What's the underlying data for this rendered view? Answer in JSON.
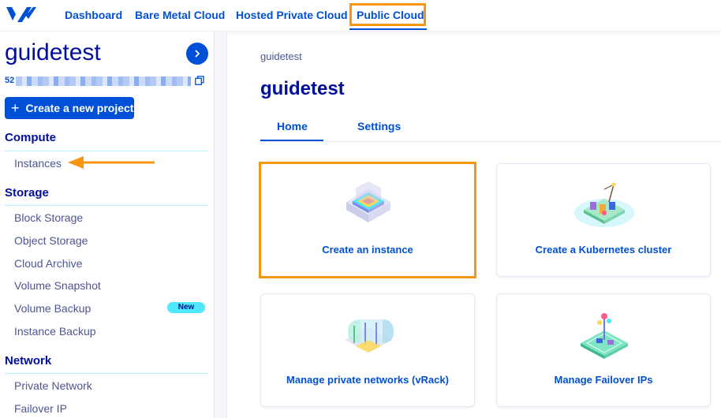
{
  "topnav": {
    "items": [
      {
        "label": "Dashboard"
      },
      {
        "label": "Bare Metal Cloud"
      },
      {
        "label": "Hosted Private Cloud"
      },
      {
        "label": "Public Cloud"
      }
    ],
    "active": "Public Cloud"
  },
  "sidebar": {
    "project_name": "guidetest",
    "project_id_prefix": "52",
    "create_project_label": "Create a new project",
    "sections": [
      {
        "title": "Compute",
        "items": [
          "Instances"
        ]
      },
      {
        "title": "Storage",
        "items": [
          "Block Storage",
          "Object Storage",
          "Cloud Archive",
          "Volume Snapshot",
          "Volume Backup",
          "Instance Backup"
        ]
      },
      {
        "title": "Network",
        "items": [
          "Private Network",
          "Failover IP"
        ]
      }
    ],
    "new_badge": "New"
  },
  "main": {
    "breadcrumb": "guidetest",
    "title": "guidetest",
    "tabs": [
      {
        "label": "Home"
      },
      {
        "label": "Settings"
      }
    ],
    "tiles": [
      {
        "label": "Create an instance"
      },
      {
        "label": "Create a Kubernetes cluster"
      },
      {
        "label": "Manage private networks (vRack)"
      },
      {
        "label": "Manage Failover IPs"
      }
    ]
  },
  "colors": {
    "brand_blue": "#0050d7",
    "navy": "#000e9c",
    "highlight_orange": "#f7960f",
    "badge_cyan": "#4ee8fa"
  },
  "icons": [
    "ovh-logo-icon",
    "chevron-right-icon",
    "copy-icon",
    "plus-icon",
    "arrow-left-icon"
  ]
}
